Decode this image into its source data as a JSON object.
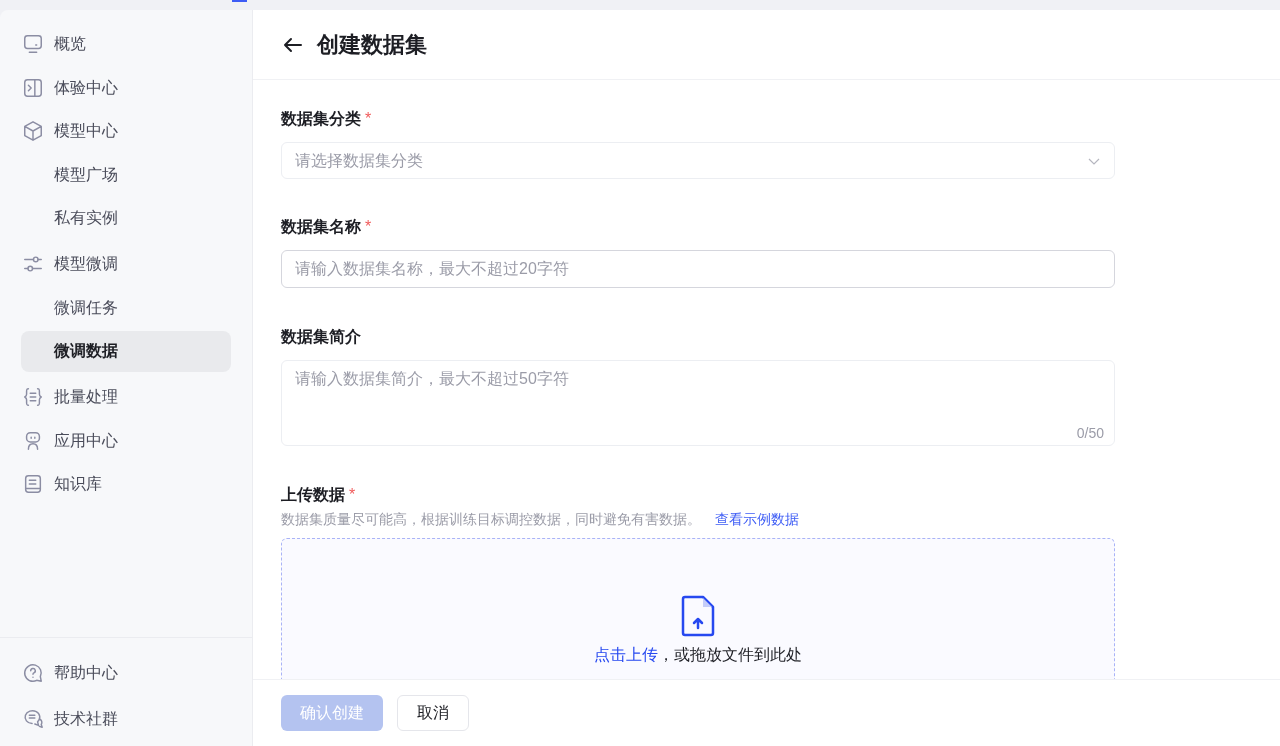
{
  "sidebar": {
    "items": [
      {
        "label": "概览",
        "selected": false
      },
      {
        "label": "体验中心",
        "selected": false
      },
      {
        "label": "模型中心",
        "selected": false,
        "children": [
          {
            "label": "模型广场",
            "selected": false
          },
          {
            "label": "私有实例",
            "selected": false
          }
        ]
      },
      {
        "label": "模型微调",
        "selected": false,
        "children": [
          {
            "label": "微调任务",
            "selected": false
          },
          {
            "label": "微调数据",
            "selected": true
          }
        ]
      },
      {
        "label": "批量处理",
        "selected": false
      },
      {
        "label": "应用中心",
        "selected": false
      },
      {
        "label": "知识库",
        "selected": false
      }
    ],
    "footer_items": [
      {
        "label": "帮助中心"
      },
      {
        "label": "技术社群"
      }
    ]
  },
  "header": {
    "title": "创建数据集"
  },
  "form": {
    "category": {
      "label": "数据集分类",
      "required_mark": "*",
      "placeholder": "请选择数据集分类"
    },
    "name": {
      "label": "数据集名称",
      "required_mark": "*",
      "placeholder": "请输入数据集名称，最大不超过20字符"
    },
    "intro": {
      "label": "数据集简介",
      "placeholder": "请输入数据集简介，最大不超过50字符",
      "counter": "0/50"
    },
    "upload": {
      "label": "上传数据",
      "required_mark": "*",
      "hint": "数据集质量尽可能高，根据训练目标调控数据，同时避免有害数据。",
      "link": "查看示例数据",
      "click_text": "点击上传",
      "drop_text": "，或拖放文件到此处"
    }
  },
  "footer": {
    "buttons": [
      {
        "label": "确认创建",
        "kind": "primary",
        "disabled": true
      },
      {
        "label": "取消",
        "kind": "secondary",
        "disabled": false
      }
    ]
  }
}
